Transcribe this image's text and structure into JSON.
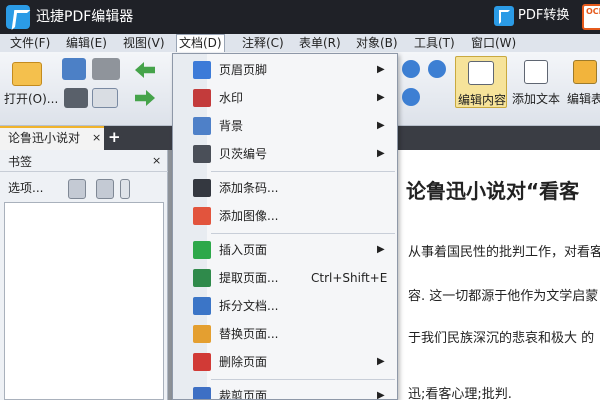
{
  "titlebar": {
    "title": "迅捷PDF编辑器",
    "pdf_convert_label": "PDF转换",
    "ocr_label": "OCR"
  },
  "menubar": {
    "items": [
      "文件(F)",
      "编辑(E)",
      "视图(V)",
      "文档(D)",
      "注释(C)",
      "表单(R)",
      "对象(B)",
      "工具(T)",
      "窗口(W)"
    ],
    "active_item": "文档(D)"
  },
  "toolbar": {
    "open_label": "打开(O)...",
    "edit_content_label": "编辑内容",
    "add_text_label": "添加文本",
    "edit_form_label": "编辑表"
  },
  "tabs": {
    "document_tab": "论鲁迅小说对",
    "close_symbol": "×",
    "add_symbol": "+"
  },
  "bookmark_panel": {
    "title": "书签",
    "close_symbol": "×",
    "options_label": "选项..."
  },
  "document": {
    "title": "论鲁迅小说对“看客",
    "lines": [
      "从事着国民性的批判工作，对看客",
      "容. 这一切都源于他作为文学启蒙",
      "于我们民族深沉的悲哀和极大 的",
      "迅;看客心理;批判."
    ]
  },
  "context_menu": {
    "items": [
      {
        "label": "页眉页脚",
        "shortcut": "",
        "submenu": true,
        "icon": "header-footer-icon",
        "color": "#3d7bd8"
      },
      {
        "label": "水印",
        "shortcut": "",
        "submenu": true,
        "icon": "watermark-icon",
        "color": "#c33b3b"
      },
      {
        "label": "背景",
        "shortcut": "",
        "submenu": true,
        "icon": "background-icon",
        "color": "#4e80c8"
      },
      {
        "label": "贝茨编号",
        "shortcut": "",
        "submenu": true,
        "icon": "bates-number-icon",
        "color": "#4a4f58"
      },
      {
        "label": "添加条码...",
        "shortcut": "",
        "submenu": false,
        "icon": "barcode-icon",
        "color": "#343840"
      },
      {
        "label": "添加图像...",
        "shortcut": "",
        "submenu": false,
        "icon": "image-icon",
        "color": "#e2543d"
      },
      {
        "label": "插入页面",
        "shortcut": "",
        "submenu": true,
        "icon": "insert-page-icon",
        "color": "#2da84a"
      },
      {
        "label": "提取页面...",
        "shortcut": "Ctrl+Shift+E",
        "submenu": false,
        "icon": "extract-page-icon",
        "color": "#2f8a4b"
      },
      {
        "label": "拆分文档...",
        "shortcut": "",
        "submenu": false,
        "icon": "split-document-icon",
        "color": "#3b75c7"
      },
      {
        "label": "替换页面...",
        "shortcut": "",
        "submenu": false,
        "icon": "replace-page-icon",
        "color": "#e49f30"
      },
      {
        "label": "删除页面",
        "shortcut": "",
        "submenu": true,
        "icon": "delete-page-icon",
        "color": "#d13a36"
      },
      {
        "label": "裁剪页面",
        "shortcut": "",
        "submenu": true,
        "icon": "crop-page-icon",
        "color": "#3d6fc4"
      }
    ],
    "arrow_symbol": "▶"
  },
  "colors": {
    "titlebar": "#1f2127",
    "accent": "#2b9be6",
    "active_tab": "#f0b32c",
    "selected_tool": "#f6e39a"
  }
}
